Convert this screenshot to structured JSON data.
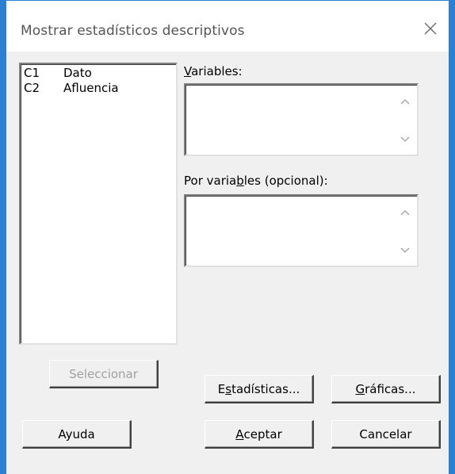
{
  "window": {
    "title": "Mostrar estadísticos descriptivos"
  },
  "columns_list": {
    "items": [
      {
        "id": "C1",
        "name": "Dato"
      },
      {
        "id": "C2",
        "name": "Afluencia"
      }
    ]
  },
  "fields": {
    "variables_label_prefix": "",
    "variables_label_mnemonic": "V",
    "variables_label_rest": "ariables:",
    "variables_value": "",
    "by_variables_label_prefix": "Por varia",
    "by_variables_label_mnemonic": "b",
    "by_variables_label_rest": "les (opcional):",
    "by_variables_value": ""
  },
  "buttons": {
    "select": "Seleccionar",
    "statistics_prefix": "E",
    "statistics_mnemonic": "s",
    "statistics_rest": "tadísticas...",
    "graphs_prefix": "",
    "graphs_mnemonic": "G",
    "graphs_rest": "ráficas...",
    "help": "Ayuda",
    "ok_prefix": "",
    "ok_mnemonic": "A",
    "ok_rest": "ceptar",
    "cancel": "Cancelar"
  },
  "colors": {
    "frame_accent": "#2b7fd4",
    "dialog_background": "#f0f0f0",
    "disabled_text": "#a0a0a0"
  }
}
